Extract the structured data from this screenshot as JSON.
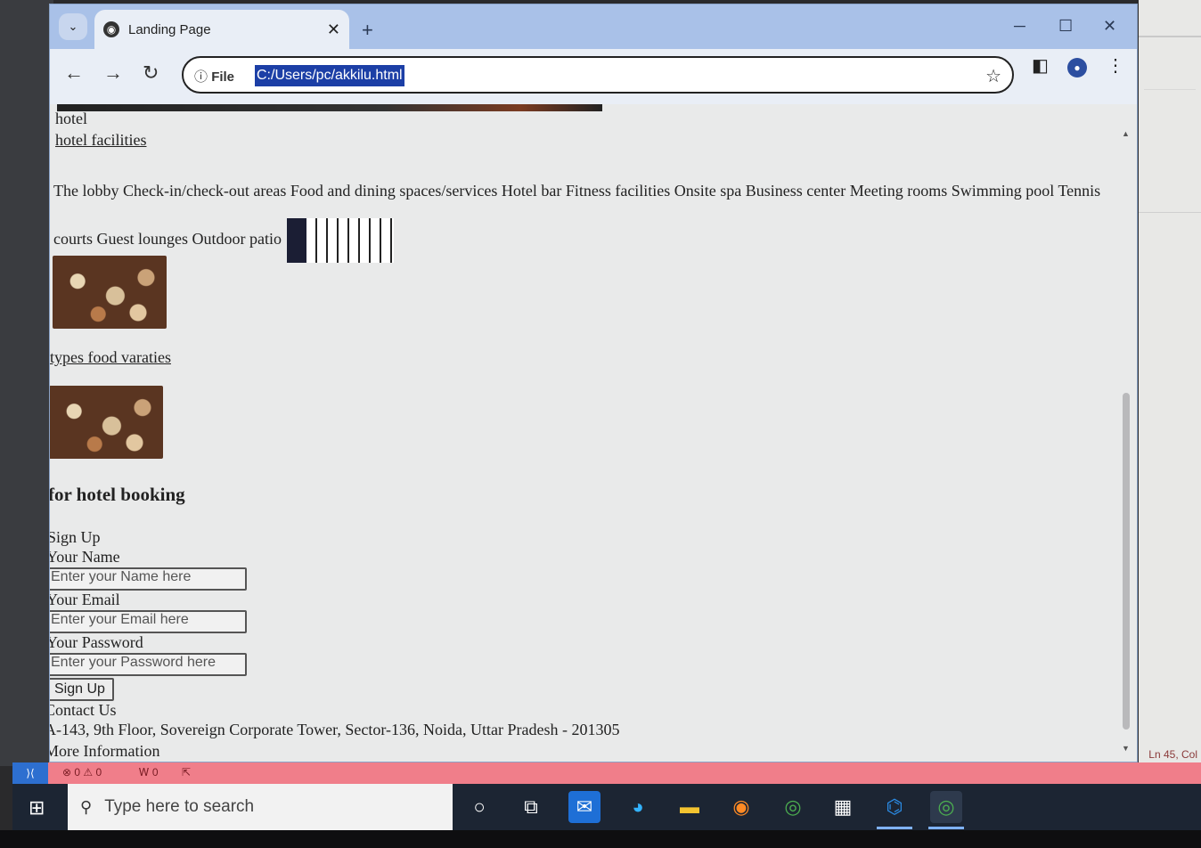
{
  "browser": {
    "tab_title": "Landing Page",
    "new_tab": "+",
    "address_prefix": "File",
    "url": "C:/Users/pc/akkilu.html"
  },
  "page": {
    "hotel": "hotel",
    "facilities_link": "hotel facilities",
    "facilities_list": "The lobby Check-in/check-out areas Food and dining spaces/services Hotel bar Fitness facilities Onsite spa Business center Meeting rooms Swimming pool Tennis courts Guest lounges Outdoor patio",
    "types_link": "types food varaties",
    "booking_heading": "for hotel booking",
    "signup_heading": "Sign Up",
    "name_label": "Your Name",
    "name_placeholder": "Enter your Name here",
    "email_label": "Your Email",
    "email_placeholder": "Enter your Email here",
    "password_label": "Your Password",
    "password_placeholder": "Enter your Password here",
    "signup_button": "Sign Up",
    "contact": "Contact Us",
    "address": "A-143, 9th Floor, Sovereign Corporate Tower, Sector-136, Noida, Uttar Pradesh - 201305",
    "more_info": "More Information"
  },
  "statusbar": {
    "problems": "⊗ 0 ⚠ 0",
    "warnings": "Ꮃ 0",
    "position": "Ln 45, Col"
  },
  "taskbar": {
    "search_placeholder": "Type here to search"
  }
}
